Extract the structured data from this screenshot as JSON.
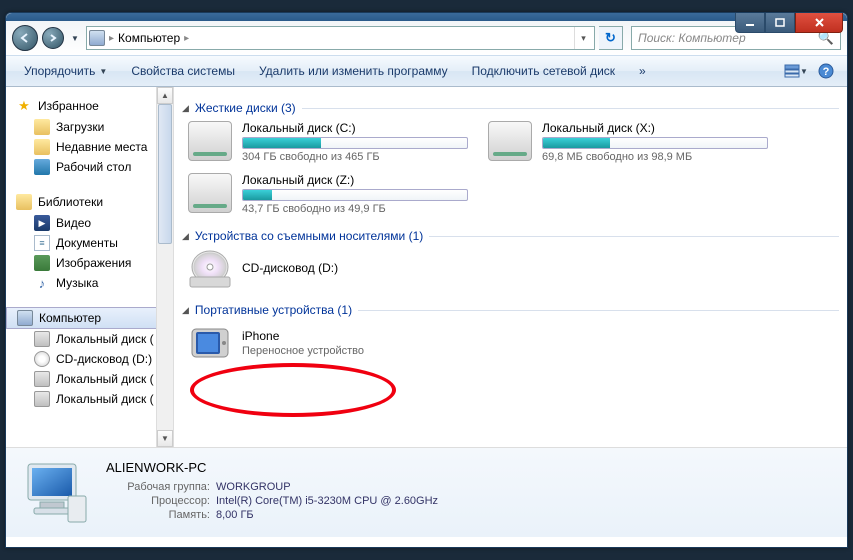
{
  "window": {
    "breadcrumb_root": "Компьютер",
    "search_placeholder": "Поиск: Компьютер"
  },
  "toolbar": {
    "organize": "Упорядочить",
    "system_props": "Свойства системы",
    "uninstall": "Удалить или изменить программу",
    "map_drive": "Подключить сетевой диск",
    "overflow": "»"
  },
  "sidebar": {
    "favorites": {
      "label": "Избранное",
      "downloads": "Загрузки",
      "recent": "Недавние места",
      "desktop": "Рабочий стол"
    },
    "libraries": {
      "label": "Библиотеки",
      "video": "Видео",
      "documents": "Документы",
      "pictures": "Изображения",
      "music": "Музыка"
    },
    "computer": {
      "label": "Компьютер",
      "local_c": "Локальный диск (",
      "dvd": "CD-дисковод (D:)",
      "local_x": "Локальный диск (",
      "local_z": "Локальный диск ("
    }
  },
  "main": {
    "hdd_section": "Жесткие диски (3)",
    "removable_section": "Устройства со съемными носителями (1)",
    "portable_section": "Портативные устройства (1)",
    "drives": {
      "c": {
        "name": "Локальный диск (C:)",
        "free": "304 ГБ свободно из 465 ГБ",
        "fill": 35
      },
      "x": {
        "name": "Локальный диск (X:)",
        "free": "69,8 МБ свободно из 98,9 МБ",
        "fill": 30
      },
      "z": {
        "name": "Локальный диск (Z:)",
        "free": "43,7 ГБ свободно из 49,9 ГБ",
        "fill": 13
      }
    },
    "dvd": {
      "name": "CD-дисковод (D:)"
    },
    "portable": {
      "name": "iPhone",
      "desc": "Переносное устройство"
    }
  },
  "details": {
    "title": "ALIENWORK-PC",
    "workgroup_label": "Рабочая группа:",
    "workgroup": "WORKGROUP",
    "cpu_label": "Процессор:",
    "cpu": "Intel(R) Core(TM) i5-3230M CPU @ 2.60GHz",
    "ram_label": "Память:",
    "ram": "8,00 ГБ"
  }
}
